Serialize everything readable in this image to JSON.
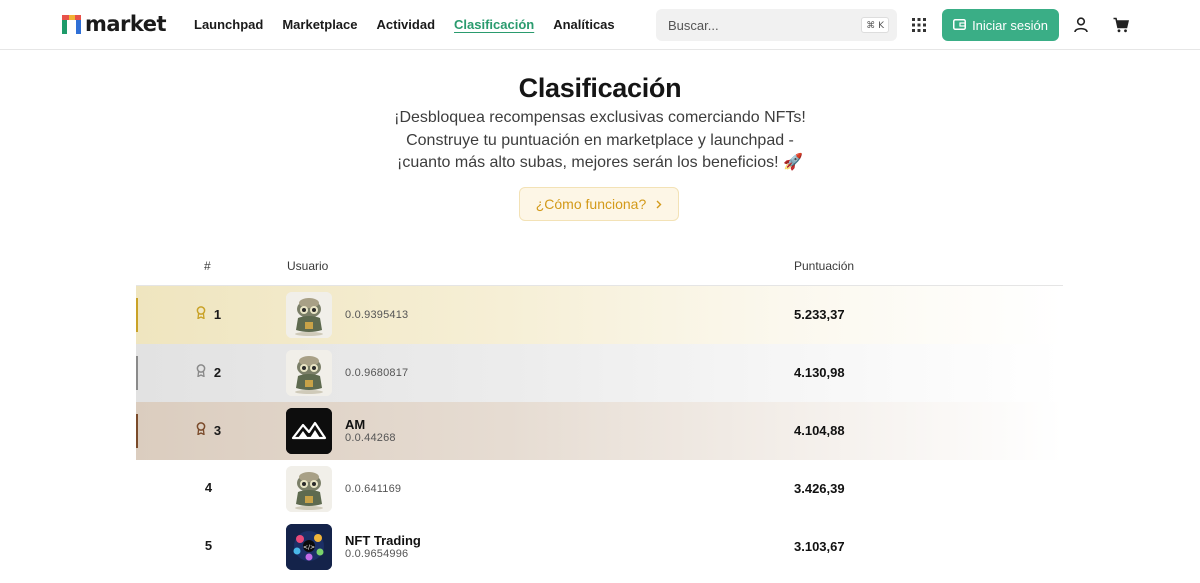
{
  "header": {
    "logo_text": "market",
    "nav": [
      {
        "label": "Launchpad"
      },
      {
        "label": "Marketplace"
      },
      {
        "label": "Actividad"
      },
      {
        "label": "Clasificación"
      },
      {
        "label": "Analíticas"
      }
    ],
    "search": {
      "placeholder": "Buscar...",
      "shortcut": "⌘ K"
    },
    "login_label": "Iniciar sesión",
    "icons": [
      "apps-grid-icon",
      "wallet-icon",
      "user-icon",
      "cart-icon"
    ]
  },
  "hero": {
    "title": "Clasificación",
    "subtitle_line1": "¡Desbloquea recompensas exclusivas comerciando NFTs!",
    "subtitle_line2": "Construye tu puntuación en marketplace y launchpad -",
    "subtitle_line3": "¡cuanto más alto subas, mejores serán los beneficios! 🚀",
    "how_button": "¿Cómo funciona?"
  },
  "table": {
    "headers": {
      "rank": "#",
      "user": "Usuario",
      "score": "Puntuación"
    },
    "rows": [
      {
        "rank": "1",
        "name": "",
        "id": "0.0.9395413",
        "score": "5.233,37",
        "medal": "gold"
      },
      {
        "rank": "2",
        "name": "",
        "id": "0.0.9680817",
        "score": "4.130,98",
        "medal": "silver"
      },
      {
        "rank": "3",
        "name": "AM",
        "id": "0.0.44268",
        "score": "4.104,88",
        "medal": "bronze"
      },
      {
        "rank": "4",
        "name": "",
        "id": "0.0.641169",
        "score": "3.426,39",
        "medal": ""
      },
      {
        "rank": "5",
        "name": "NFT Trading",
        "id": "0.0.9654996",
        "score": "3.103,67",
        "medal": ""
      }
    ]
  },
  "colors": {
    "accent": "#3aae86",
    "gold": "#c9a227",
    "silver": "#8a8a8a",
    "bronze": "#7a4a2a"
  }
}
